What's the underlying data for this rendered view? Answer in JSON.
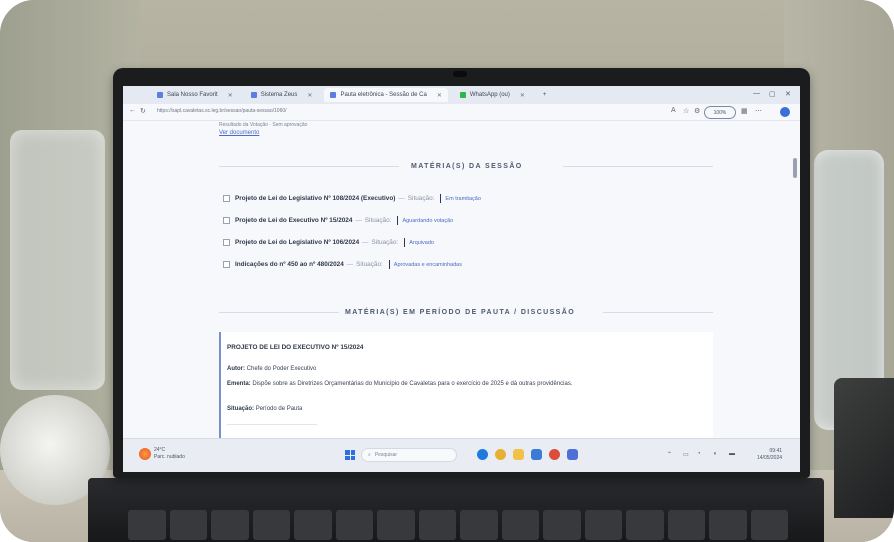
{
  "browser": {
    "tabs": [
      {
        "label": "Sala Nosso Favorit"
      },
      {
        "label": "Sistema Zeus"
      },
      {
        "label": "Pauta eletrônica - Sessão de Ca"
      },
      {
        "label": "WhatsApp (ou)"
      }
    ],
    "active_tab_index": 2,
    "url": "https://sapl.cavaletas.sc.leg.br/sessao/pauta-sessao/1060/",
    "zoom": "100%"
  },
  "page": {
    "prev_line": "Resultado da Votação · Sem aprovação",
    "prev_link": "Ver documento",
    "section1_title": "MATÉRIA(S) DA SESSÃO",
    "section2_title": "MATÉRIA(S) EM PERÍODO DE PAUTA / DISCUSSÃO",
    "items": [
      {
        "title": "Projeto de Lei do Legislativo Nº 108/2024 (Executivo)",
        "sep": "—",
        "status_label": "Situação:",
        "value": "Em tramitação"
      },
      {
        "title": "Projeto de Lei do Executivo Nº 15/2024",
        "sep": "—",
        "status_label": "Situação:",
        "value": "Aguardando votação"
      },
      {
        "title": "Projeto de Lei do Legislativo Nº 106/2024",
        "sep": "—",
        "status_label": "Situação:",
        "value": "Arquivado"
      },
      {
        "title": "Indicações do nº 450 ao nº 480/2024",
        "sep": "—",
        "status_label": "Situação:",
        "value": "Aprovadas e encaminhadas"
      }
    ],
    "card": {
      "title": "PROJETO DE LEI DO EXECUTIVO Nº 15/2024",
      "author_label": "Autor:",
      "author": "Chefe do Poder Executivo",
      "summary_label": "Ementa:",
      "summary": "Dispõe sobre as Diretrizes Orçamentárias do Município de Cavaletas para o exercício de 2025 e dá outras providências.",
      "status_label": "Situação:",
      "status": "Período de Pauta"
    }
  },
  "taskbar": {
    "weather_temp": "24°C",
    "weather_desc": "Parc. nublado",
    "search_placeholder": "Pesquisar",
    "clock_time": "09:41",
    "clock_date": "14/05/2024"
  },
  "colors": {
    "accent": "#4b6bc5",
    "card_border": "#7a8fd0",
    "bezel": "#1b1c1e"
  }
}
